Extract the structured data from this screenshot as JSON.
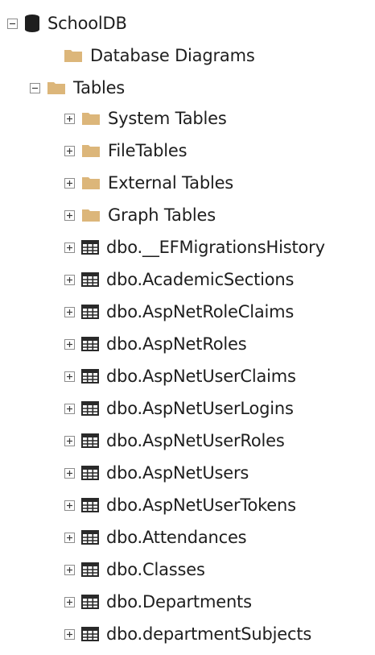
{
  "tree": {
    "root": {
      "label": "SchoolDB",
      "icon": "database-icon",
      "expanded": true
    },
    "database_diagrams": {
      "label": "Database Diagrams",
      "icon": "folder-icon"
    },
    "tables": {
      "label": "Tables",
      "icon": "folder-icon",
      "expanded": true,
      "folders": [
        {
          "label": "System Tables",
          "icon": "folder-icon"
        },
        {
          "label": "FileTables",
          "icon": "folder-icon"
        },
        {
          "label": "External Tables",
          "icon": "folder-icon"
        },
        {
          "label": "Graph Tables",
          "icon": "folder-icon"
        }
      ],
      "items": [
        {
          "label": "dbo.__EFMigrationsHistory",
          "icon": "table-icon"
        },
        {
          "label": "dbo.AcademicSections",
          "icon": "table-icon"
        },
        {
          "label": "dbo.AspNetRoleClaims",
          "icon": "table-icon"
        },
        {
          "label": "dbo.AspNetRoles",
          "icon": "table-icon"
        },
        {
          "label": "dbo.AspNetUserClaims",
          "icon": "table-icon"
        },
        {
          "label": "dbo.AspNetUserLogins",
          "icon": "table-icon"
        },
        {
          "label": "dbo.AspNetUserRoles",
          "icon": "table-icon"
        },
        {
          "label": "dbo.AspNetUsers",
          "icon": "table-icon"
        },
        {
          "label": "dbo.AspNetUserTokens",
          "icon": "table-icon"
        },
        {
          "label": "dbo.Attendances",
          "icon": "table-icon"
        },
        {
          "label": "dbo.Classes",
          "icon": "table-icon"
        },
        {
          "label": "dbo.Departments",
          "icon": "table-icon"
        },
        {
          "label": "dbo.departmentSubjects",
          "icon": "table-icon"
        }
      ]
    }
  },
  "colors": {
    "folder": "#dcb67a",
    "database": "#1e1e1e",
    "table": "#2a2a2a",
    "expander_border": "#8c8c8c",
    "expander_sign": "#3a3a3a",
    "text": "#1e1e1e"
  }
}
